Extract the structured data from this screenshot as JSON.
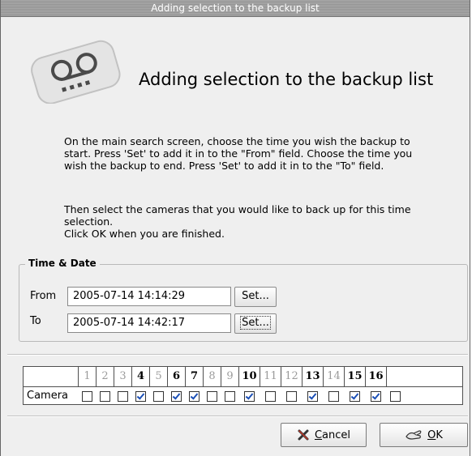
{
  "window": {
    "title": "Adding selection to the backup list"
  },
  "header": {
    "icon": "backup-tape-icon",
    "title": "Adding selection to the backup list"
  },
  "instructions": {
    "paragraph1": "On the main search screen, choose the time you wish the backup to start. Press 'Set' to add it in to the \"From\" field. Choose the time you wish the backup to end. Press 'Set' to add it in to the \"To\" field.",
    "paragraph2_line1": "Then select the cameras that you would like to back up for this time selection.",
    "paragraph2_line2": "Click OK when you are finished."
  },
  "time_date": {
    "group_title": "Time & Date",
    "from_label": "From",
    "from_value": "2005-07-14 14:14:29",
    "to_label": "To",
    "to_value": "2005-07-14 14:42:17",
    "set_label": "Set..."
  },
  "cameras": {
    "row_label": "Camera",
    "items": [
      {
        "number": "1",
        "available": false,
        "checked": false
      },
      {
        "number": "2",
        "available": false,
        "checked": false
      },
      {
        "number": "3",
        "available": false,
        "checked": false
      },
      {
        "number": "4",
        "available": true,
        "checked": true
      },
      {
        "number": "5",
        "available": false,
        "checked": false
      },
      {
        "number": "6",
        "available": true,
        "checked": true
      },
      {
        "number": "7",
        "available": true,
        "checked": true
      },
      {
        "number": "8",
        "available": false,
        "checked": false
      },
      {
        "number": "9",
        "available": false,
        "checked": false
      },
      {
        "number": "10",
        "available": true,
        "checked": true
      },
      {
        "number": "11",
        "available": false,
        "checked": false
      },
      {
        "number": "12",
        "available": false,
        "checked": false
      },
      {
        "number": "13",
        "available": true,
        "checked": true
      },
      {
        "number": "14",
        "available": false,
        "checked": false
      },
      {
        "number": "15",
        "available": true,
        "checked": true
      },
      {
        "number": "16",
        "available": true,
        "checked": true
      }
    ]
  },
  "buttons": {
    "cancel_mnemonic": "C",
    "cancel_rest": "ancel",
    "ok_mnemonic": "O",
    "ok_rest": "K"
  },
  "colors": {
    "title_bar": "#a0a0a0",
    "window_bg": "#efefef",
    "check_color": "#1b4fb6"
  }
}
